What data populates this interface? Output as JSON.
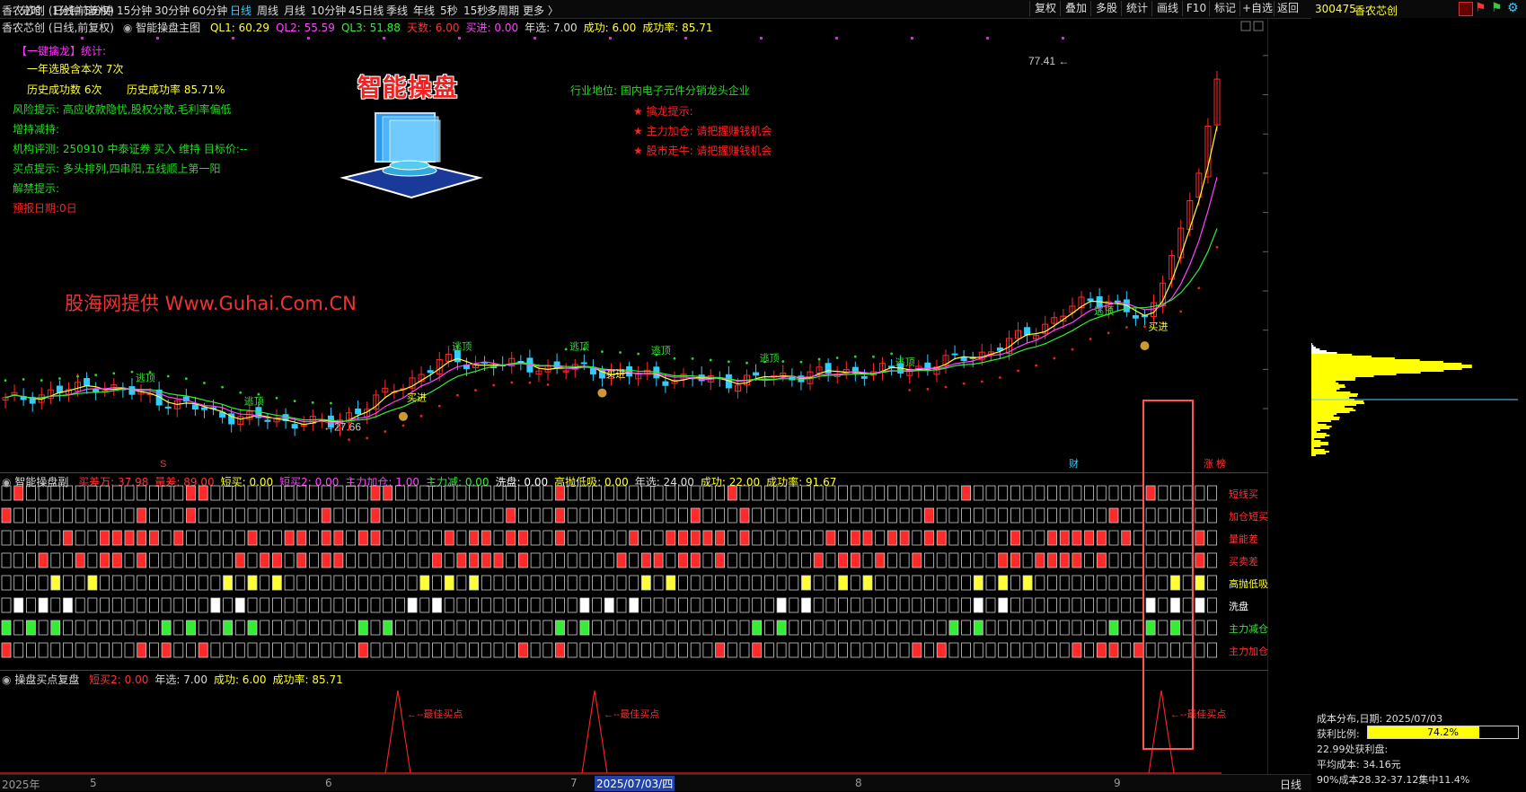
{
  "toolbar": {
    "stock_label": "香农芯创 (日线,前复权)",
    "periods": [
      "分时",
      "1分钟",
      "5分钟",
      "15分钟",
      "30分钟",
      "60分钟",
      "日线",
      "周线",
      "月线",
      "10分钟",
      "45日线",
      "季线",
      "年线",
      "5秒",
      "15秒",
      "多周期",
      "更多 〉"
    ],
    "active_period": "日线",
    "right_buttons": [
      "复权",
      "叠加",
      "多股",
      "统计",
      "画线",
      "F10",
      "标记",
      "+自选",
      "返回"
    ]
  },
  "stock_header": {
    "code": "300475",
    "name": "香农芯创"
  },
  "main_panel": {
    "indicator_name": "智能操盘主图",
    "status": [
      {
        "label": "QL1: 60.29",
        "color": "#ffff33"
      },
      {
        "label": "QL2: 55.59",
        "color": "#ff44ff"
      },
      {
        "label": "QL3: 51.88",
        "color": "#33ee33"
      },
      {
        "label": "天数: 6.00",
        "color": "#ff3333"
      },
      {
        "label": "买进: 0.00",
        "color": "#ff44ff"
      },
      {
        "label": "年选: 7.00",
        "color": "#dddddd"
      },
      {
        "label": "成功: 6.00",
        "color": "#ffff33"
      },
      {
        "label": "成功率: 85.71",
        "color": "#ffff33"
      }
    ],
    "left_info": {
      "title": "【一键擒龙】统计:",
      "line1": "一年选股含本次  7次",
      "line2a": "历史成功数  6次",
      "line2b": "历史成功率  85.71%",
      "risk_label": "风险提示:",
      "risk_text": "高应收款隐忧,股权分散,毛利率偏低",
      "hold_change": "增持减持:",
      "org_rating": "机构评测:  250910  中泰证券  买入  维持  目标价:--",
      "buy_tip": "买点提示:  多头排列,四串阳,五线顺上第一阳",
      "unlock": "解禁提示:",
      "report_date": "预报日期:0日"
    },
    "logo_text": "智能操盘",
    "watermark": "股海网提供 Www.Guhai.Com.CN",
    "industry": "行业地位:  国内电子元件分销龙头企业",
    "stars": [
      "★ 擒龙提示:",
      "★ 主力加仓:  请把握赚钱机会",
      "★ 股市走牛:  请把握赚钱机会"
    ],
    "high_label": "77.41",
    "low_label": "←27.66",
    "y_ticks": [
      "75.00",
      "70.00",
      "65.00",
      "60.00",
      "55.00",
      "50.00",
      "45.00",
      "40.00",
      "35.00",
      "30.00"
    ],
    "signals_escape": "逃顶",
    "signals_buy": "买进",
    "bottom_tags": {
      "s": "S",
      "cai": "财",
      "zhangting": "涨 榜"
    }
  },
  "sub_panel1": {
    "indicator_name": "智能操盘副",
    "status": [
      {
        "label": "买差万: 37.98",
        "color": "#ff3333"
      },
      {
        "label": "量差: 89.00",
        "color": "#ff3333"
      },
      {
        "label": "短买: 0.00",
        "color": "#ffff33"
      },
      {
        "label": "短买2: 0.00",
        "color": "#ff44ff"
      },
      {
        "label": "主力加仓: 1.00",
        "color": "#ff44ff"
      },
      {
        "label": "主力减: 0.00",
        "color": "#33ee33"
      },
      {
        "label": "洗盘: 0.00",
        "color": "#ffffff"
      },
      {
        "label": "高抛低吸: 0.00",
        "color": "#ffff33"
      },
      {
        "label": "年选: 24.00",
        "color": "#dddddd"
      },
      {
        "label": "成功: 22.00",
        "color": "#ffff33"
      },
      {
        "label": "成功率: 91.67",
        "color": "#ffff33"
      }
    ],
    "y_ticks": [
      "12.00",
      "10.00",
      "8.00",
      "6.00",
      "4.00",
      "2.00"
    ],
    "row_labels": [
      {
        "text": "短线买",
        "color": "#ff3333"
      },
      {
        "text": "加仓短买",
        "color": "#ff3333"
      },
      {
        "text": "量能差",
        "color": "#ff3333"
      },
      {
        "text": "买卖差",
        "color": "#ff3333"
      },
      {
        "text": "高抛低吸",
        "color": "#ffff33"
      },
      {
        "text": "洗盘",
        "color": "#ffffff"
      },
      {
        "text": "主力减仓",
        "color": "#33ee33"
      },
      {
        "text": "主力加仓",
        "color": "#ff3333"
      }
    ]
  },
  "sub_panel2": {
    "indicator_name": "操盘买点复盘",
    "status": [
      {
        "label": "短买2: 0.00",
        "color": "#ff3333"
      },
      {
        "label": "年选: 7.00",
        "color": "#dddddd"
      },
      {
        "label": "成功: 6.00",
        "color": "#ffff33"
      },
      {
        "label": "成功率: 85.71",
        "color": "#ffff33"
      }
    ],
    "y_ticks": [
      "1.00",
      "0.50"
    ],
    "best_buy": "←--最佳买点"
  },
  "bottom_axis": {
    "labels": [
      "2025年",
      "5",
      "6",
      "7",
      "8",
      "9"
    ],
    "cursor_date": "2025/07/03/四",
    "period": "日线"
  },
  "cost_panel": {
    "title": "成本分布,日期:  2025/07/03",
    "profit_label": "获利比例:",
    "profit_value": "74.2%",
    "profit_ratio": 0.742,
    "profit_at": "22.99处获利盘:",
    "avg_cost": "平均成本:  34.16元",
    "concentration": "90%成本28.32-37.12集中11.4%"
  },
  "colors": {
    "up": "#ff2a2a",
    "down": "#33ccff",
    "ma1": "#ffff33",
    "ma2": "#ff44ff",
    "ma3": "#33ee33",
    "highlight": "#ff5555"
  }
}
